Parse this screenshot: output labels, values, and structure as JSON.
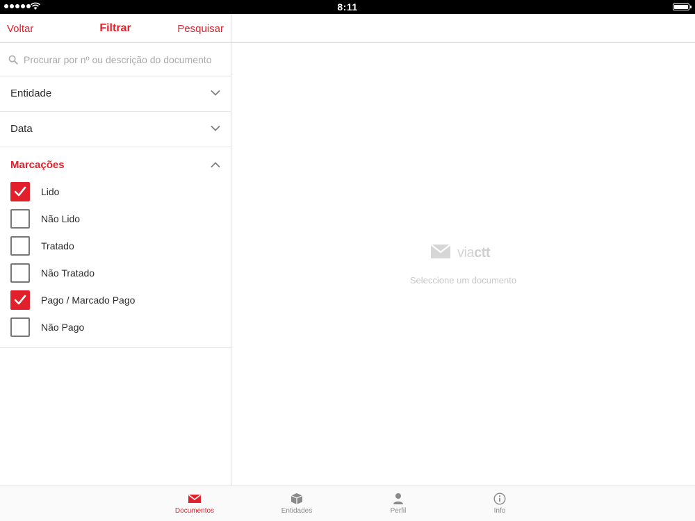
{
  "status_bar": {
    "time": "8:11"
  },
  "filter_panel": {
    "back_label": "Voltar",
    "title": "Filtrar",
    "search_label": "Pesquisar",
    "search": {
      "placeholder": "Procurar por nº ou descrição do documento",
      "value": ""
    },
    "sections": [
      {
        "label": "Entidade",
        "expanded": false
      },
      {
        "label": "Data",
        "expanded": false
      }
    ],
    "marcacoes": {
      "title": "Marcações",
      "expanded": true,
      "options": [
        {
          "label": "Lido",
          "checked": true
        },
        {
          "label": "Não Lido",
          "checked": false
        },
        {
          "label": "Tratado",
          "checked": false
        },
        {
          "label": "Não Tratado",
          "checked": false
        },
        {
          "label": "Pago / Marcado Pago",
          "checked": true
        },
        {
          "label": "Não Pago",
          "checked": false
        }
      ]
    }
  },
  "detail": {
    "brand_light": "via",
    "brand_bold": "ctt",
    "empty_message": "Seleccione um documento"
  },
  "tabbar": {
    "tabs": [
      {
        "label": "Documentos",
        "icon": "envelope-icon",
        "active": true
      },
      {
        "label": "Entidades",
        "icon": "box-icon",
        "active": false
      },
      {
        "label": "Perfil",
        "icon": "person-icon",
        "active": false
      },
      {
        "label": "Info",
        "icon": "info-icon",
        "active": false
      }
    ]
  },
  "colors": {
    "accent": "#e2202b",
    "text": "#2b2b2b",
    "muted": "#a9a9a9"
  }
}
